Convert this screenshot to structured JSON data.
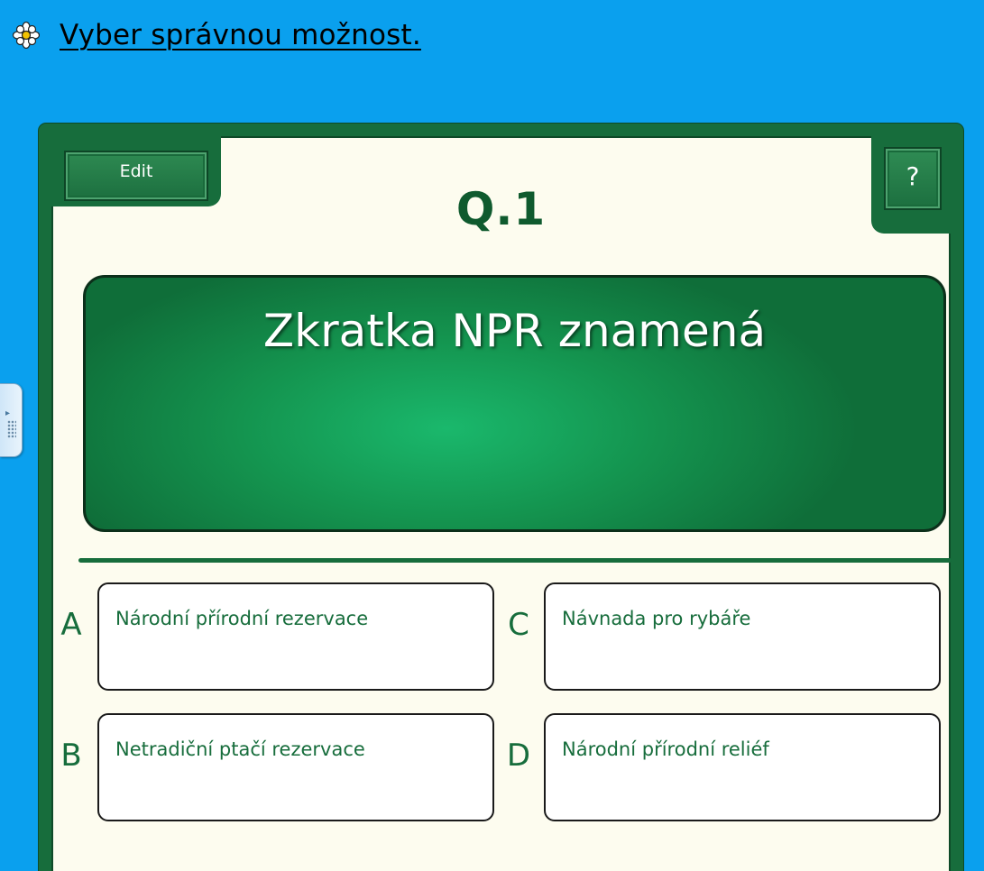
{
  "instruction": "Vyber správnou možnost.",
  "quiz": {
    "edit_label": "Edit",
    "help_label": "?",
    "question_number": "Q.1",
    "question": "Zkratka NPR znamená",
    "answers": [
      {
        "letter": "A",
        "text": "Národní přírodní rezervace"
      },
      {
        "letter": "B",
        "text": "Netradiční ptačí rezervace"
      },
      {
        "letter": "C",
        "text": "Návnada pro rybáře"
      },
      {
        "letter": "D",
        "text": "Národní přírodní reliéf"
      }
    ]
  },
  "colors": {
    "background": "#0aa0ee",
    "frame_green": "#176d3c",
    "panel_cream": "#fdfcef",
    "question_panel_green": "#14944f"
  },
  "icons": {
    "instruction_bullet": "flower-icon",
    "side_handle": "grip-icon"
  }
}
